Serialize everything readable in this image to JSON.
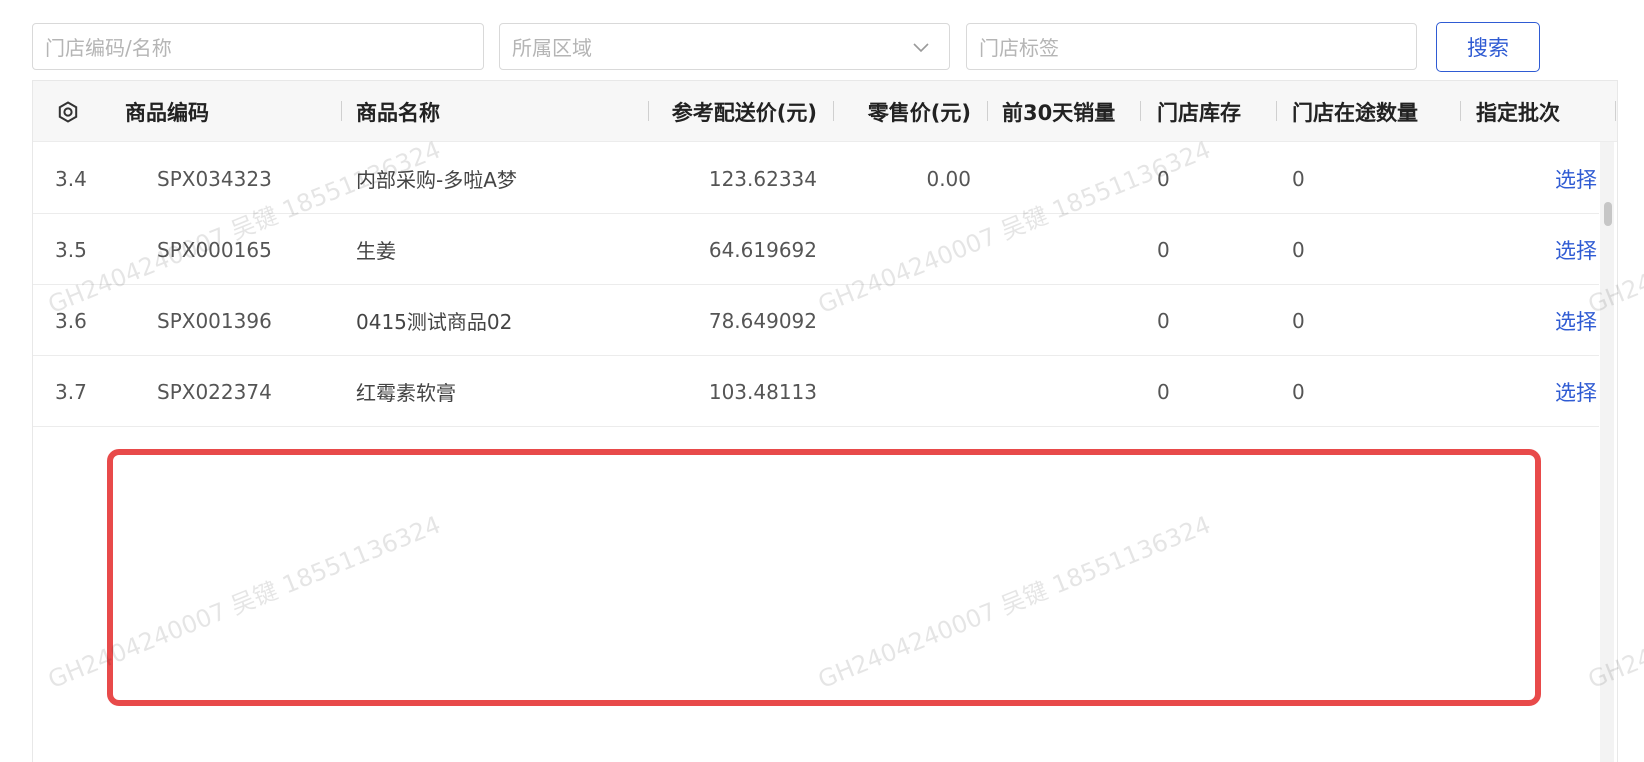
{
  "filters": {
    "store_code_placeholder": "门店编码/名称",
    "region_placeholder": "所属区域",
    "store_tag_placeholder": "门店标签",
    "search_label": "搜索"
  },
  "table": {
    "headers": {
      "settings_icon": "gear-icon",
      "code": "商品编码",
      "name": "商品名称",
      "ref_price": "参考配送价(元)",
      "retail_price": "零售价(元)",
      "sales_30d": "前30天销量",
      "store_stock": "门店库存",
      "in_transit": "门店在途数量",
      "batch": "指定批次"
    },
    "rows": [
      {
        "index": "3.4",
        "code": "SPX034323",
        "name": "内部采购-多啦A梦",
        "ref_price": "123.62334",
        "retail_price": "0.00",
        "sales_30d": "",
        "store_stock": "0",
        "in_transit": "0",
        "batch_action": "选择"
      },
      {
        "index": "3.5",
        "code": "SPX000165",
        "name": "生姜",
        "ref_price": "64.619692",
        "retail_price": "",
        "sales_30d": "",
        "store_stock": "0",
        "in_transit": "0",
        "batch_action": "选择"
      },
      {
        "index": "3.6",
        "code": "SPX001396",
        "name": "0415测试商品02",
        "ref_price": "78.649092",
        "retail_price": "",
        "sales_30d": "",
        "store_stock": "0",
        "in_transit": "0",
        "batch_action": "选择"
      },
      {
        "index": "3.7",
        "code": "SPX022374",
        "name": "红霉素软膏",
        "ref_price": "103.48113",
        "retail_price": "",
        "sales_30d": "",
        "store_stock": "0",
        "in_transit": "0",
        "batch_action": "选择"
      }
    ]
  },
  "watermark": {
    "text": "GH2404240007 吴键 18551136324"
  },
  "colors": {
    "accent": "#2f5bd3",
    "highlight": "#e84a4a"
  }
}
